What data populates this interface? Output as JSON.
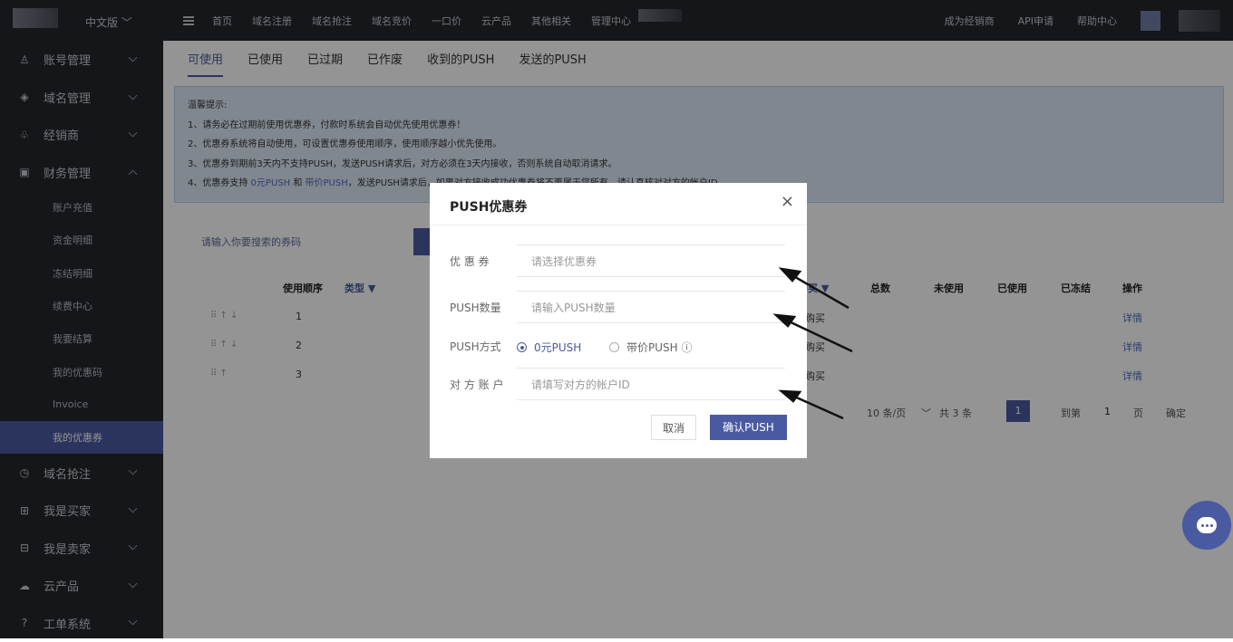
{
  "topbar": {
    "lang": "中文版 ﹀",
    "nav": [
      "首页",
      "域名注册",
      "域名抢注",
      "域名竞价",
      "一口价",
      "云产品",
      "其他相关",
      "管理中心"
    ],
    "right": [
      "成为经销商",
      "API申请",
      "帮助中心"
    ]
  },
  "sidebar": {
    "groups": [
      {
        "label": "账号管理",
        "icon": "user-icon"
      },
      {
        "label": "域名管理",
        "icon": "layers-icon"
      },
      {
        "label": "经销商",
        "icon": "people-icon"
      },
      {
        "label": "财务管理",
        "icon": "finance-icon"
      }
    ],
    "sub": [
      "账户充值",
      "资金明细",
      "冻结明细",
      "续费中心",
      "我要结算",
      "我的优惠码",
      "Invoice",
      "我的优惠券"
    ],
    "groups2": [
      {
        "label": "域名抢注",
        "icon": "clock-icon"
      },
      {
        "label": "我是买家",
        "icon": "cart-icon"
      },
      {
        "label": "我是卖家",
        "icon": "shop-icon"
      },
      {
        "label": "云产品",
        "icon": "cloud-icon"
      },
      {
        "label": "工单系统",
        "icon": "help-icon"
      }
    ]
  },
  "tabs": [
    "可使用",
    "已使用",
    "已过期",
    "已作废",
    "收到的PUSH",
    "发送的PUSH"
  ],
  "notice": {
    "title": "温馨提示:",
    "l1": "1、请务必在过期前使用优惠券，付款时系统会自动优先使用优惠券！",
    "l2": "2、优惠券系统将自动使用，可设置优惠券使用顺序，使用顺序越小优先使用。",
    "l3": "3、优惠券到期前3天内不支持PUSH，发送PUSH请求后，对方必须在3天内接收，否则系统自动取消请求。",
    "l4a": "4、优惠券支持 ",
    "l4b": "0元PUSH",
    "l4c": " 和 ",
    "l4d": "带价PUSH",
    "l4e": "，发送PUSH请求后，如果对方接收成功优惠券将不再属于您所有，请认真核对对方的帐户ID"
  },
  "search": {
    "placeholder": "请输入你要搜索的券码"
  },
  "table": {
    "headers": [
      "使用顺序",
      "类型 ▼",
      "购买 ▼",
      "总数",
      "未使用",
      "已使用",
      "已冻结",
      "操作"
    ],
    "rows": [
      {
        "order": "1",
        "scope": "购买",
        "action": "详情"
      },
      {
        "order": "2",
        "scope": "购买",
        "action": "详情"
      },
      {
        "order": "3",
        "scope": "购买",
        "action": "详情"
      }
    ]
  },
  "pager": {
    "size": "10 条/页",
    "total": "共 3 条",
    "page": "1",
    "goto": "到第",
    "goto_val": "1",
    "unit": "页",
    "ok": "确定"
  },
  "modal": {
    "title": "PUSH优惠券",
    "close": "×",
    "coupon_label": "优 惠 券",
    "coupon_ph": "请选择优惠券",
    "qty_label": "PUSH数量",
    "qty_ph": "请输入PUSH数量",
    "method_label": "PUSH方式",
    "method_opt1": "0元PUSH",
    "method_opt2": "带价PUSH ⓘ",
    "account_label": "对 方 账 户",
    "account_ph": "请填写对方的帐户ID",
    "cancel": "取消",
    "confirm": "确认PUSH"
  },
  "colors": {
    "accent": "#4a5aa0",
    "sidebar": "#23262e"
  }
}
